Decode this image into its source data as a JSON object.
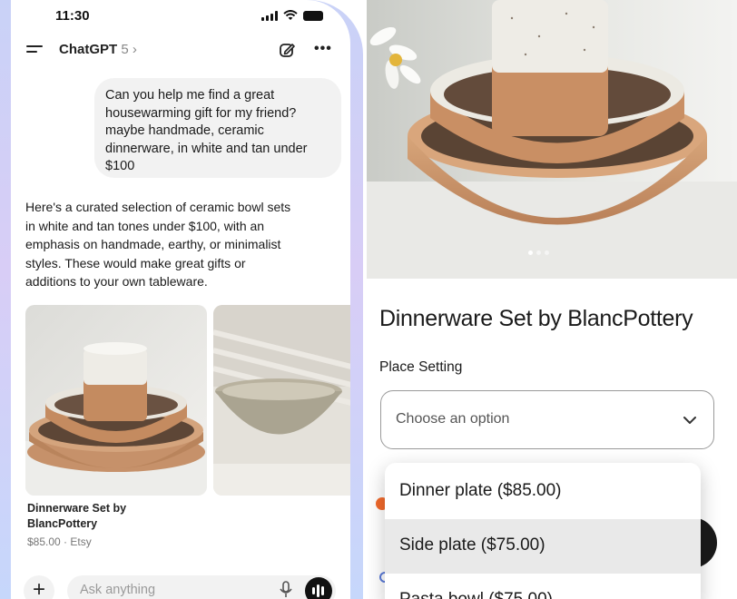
{
  "status_bar": {
    "time": "11:30"
  },
  "chat": {
    "app_name": "ChatGPT",
    "model_version": "5",
    "user_message": "Can you help me find a great\nhousewarming gift for my friend?\nmaybe handmade, ceramic\ndinnerware, in white and tan under\n$100",
    "assistant_message": "Here's a curated selection of ceramic bowl sets\nin white and tan tones under $100, with an\nemphasis on handmade, earthy, or minimalist\nstyles. These would make great gifts or\nadditions to your own tableware.",
    "product_card": {
      "title": "Dinnerware Set by\nBlancPottery",
      "price_line": "$85.00 · Etsy"
    },
    "composer": {
      "placeholder": "Ask anything"
    }
  },
  "product_page": {
    "title": "Dinnerware Set by BlancPottery",
    "option_label": "Place Setting",
    "select_placeholder": "Choose an option",
    "options": [
      "Dinner plate ($85.00)",
      "Side plate ($75.00)",
      "Pasta bowl ($75.00)"
    ],
    "highlighted_option_index": 1,
    "image_carousel": {
      "count": 3,
      "active_index": 0
    }
  },
  "colors": {
    "phone_frame": "#c9d2f7",
    "accent_orange": "#f26a2c",
    "bowl_tan": "#c8946a",
    "glaze_white": "#eeece6"
  },
  "icons": [
    "menu-icon",
    "compose-icon",
    "more-icon",
    "plus-icon",
    "mic-icon",
    "voice-mode-icon",
    "chevron-down-icon"
  ]
}
